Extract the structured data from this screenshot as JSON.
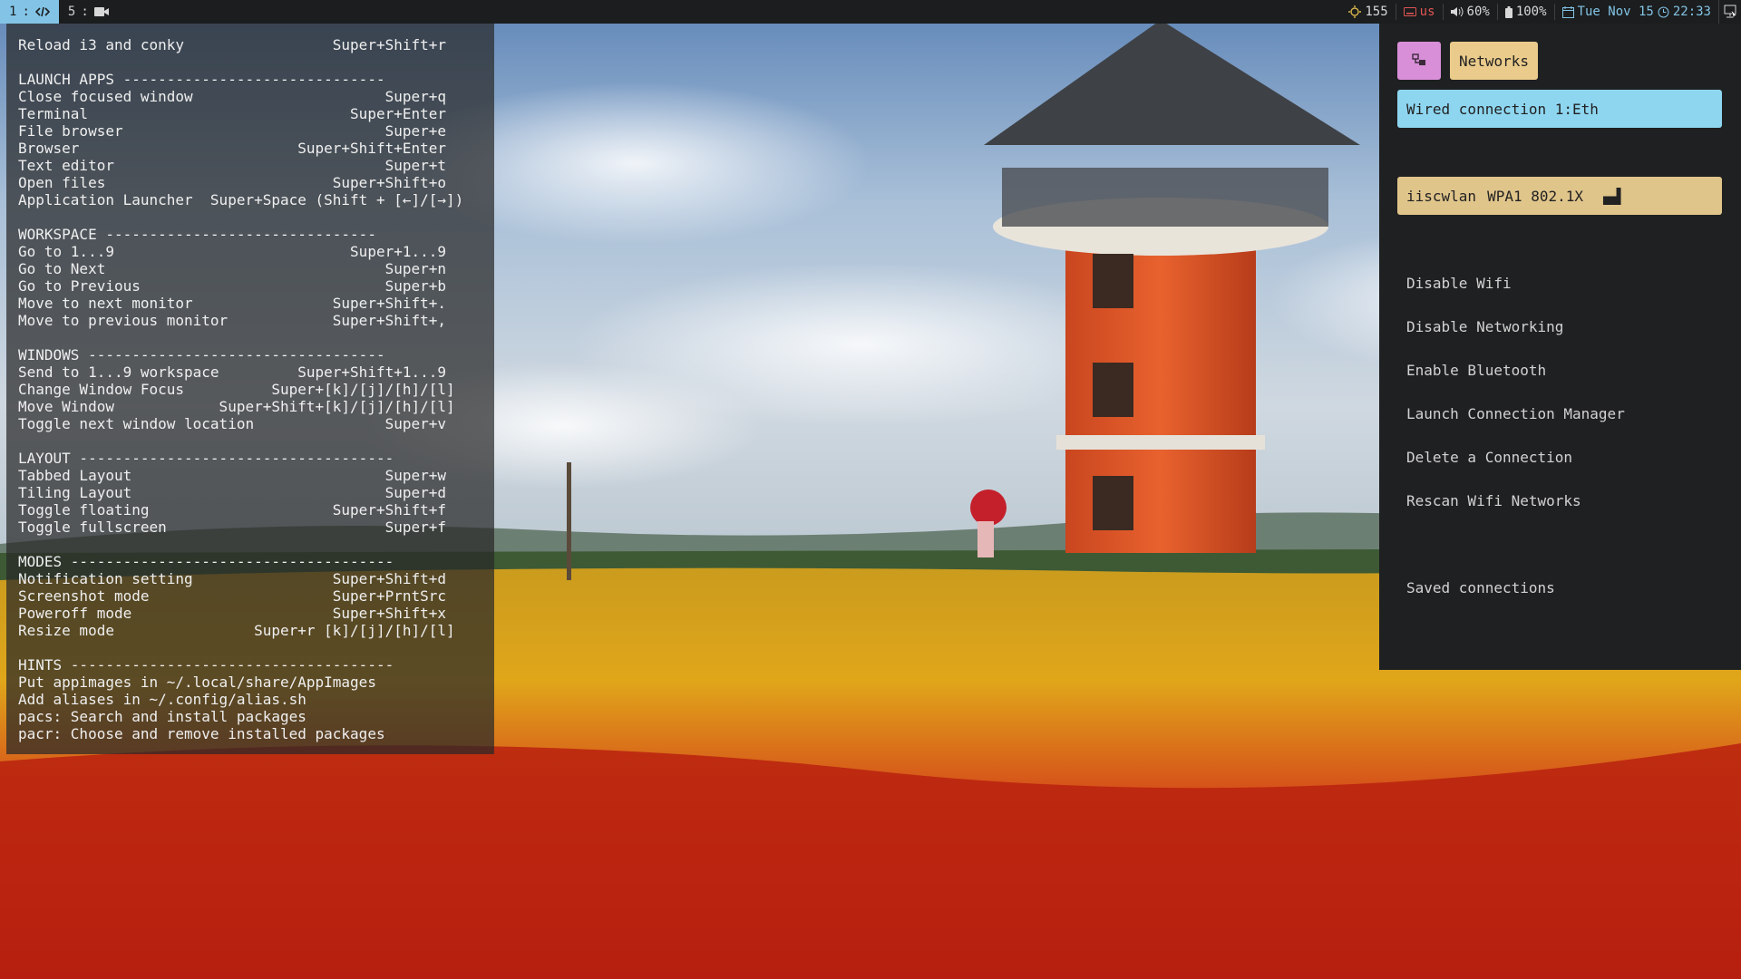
{
  "topbar": {
    "workspaces": [
      {
        "num": "1",
        "sep": ":",
        "icon": "code-icon",
        "active": true
      },
      {
        "num": "5",
        "sep": ":",
        "icon": "video-camera-icon",
        "active": false
      }
    ],
    "brightness": "155",
    "keyboard_layout": "us",
    "volume": "60%",
    "battery": "100%",
    "date": "Tue Nov 15",
    "time": "22:33",
    "accent_color": "#83c4e6",
    "keyboard_color": "#e05555"
  },
  "cheatsheet": {
    "lines": [
      "Reload i3 and conky                 Super+Shift+r",
      "",
      "LAUNCH APPS ------------------------------",
      "Close focused window                      Super+q",
      "Terminal                              Super+Enter",
      "File browser                              Super+e",
      "Browser                         Super+Shift+Enter",
      "Text editor                               Super+t",
      "Open files                          Super+Shift+o",
      "Application Launcher  Super+Space (Shift + [←]/[→])",
      "",
      "WORKSPACE -------------------------------",
      "Go to 1...9                           Super+1...9",
      "Go to Next                                Super+n",
      "Go to Previous                            Super+b",
      "Move to next monitor                Super+Shift+.",
      "Move to previous monitor            Super+Shift+,",
      "",
      "WINDOWS ----------------------------------",
      "Send to 1...9 workspace         Super+Shift+1...9",
      "Change Window Focus          Super+[k]/[j]/[h]/[l]",
      "Move Window            Super+Shift+[k]/[j]/[h]/[l]",
      "Toggle next window location               Super+v",
      "",
      "LAYOUT ------------------------------------",
      "Tabbed Layout                             Super+w",
      "Tiling Layout                             Super+d",
      "Toggle floating                     Super+Shift+f",
      "Toggle fullscreen                         Super+f",
      "",
      "MODES -------------------------------------",
      "Notification setting                Super+Shift+d",
      "Screenshot mode                     Super+PrntSrc",
      "Poweroff mode                       Super+Shift+x",
      "Resize mode                Super+r [k]/[j]/[h]/[l]",
      "",
      "HINTS -------------------------------------",
      "Put appimages in ~/.local/share/AppImages",
      "Add aliases in ~/.config/alias.sh",
      "pacs: Search and install packages",
      "pacr: Choose and remove installed packages"
    ]
  },
  "network_menu": {
    "prompt": "Networks",
    "wired": "Wired connection 1:Eth",
    "wifi_ssid": "iiscwlan",
    "wifi_security": "WPA1 802.1X",
    "wifi_signal": "▄▟",
    "options": [
      "Disable Wifi",
      "Disable Networking",
      "Enable Bluetooth",
      "Launch Connection Manager",
      "Delete a Connection",
      "Rescan Wifi Networks"
    ],
    "saved": "Saved connections",
    "colors": {
      "mode_button": "#d88fd8",
      "prompt": "#eacb8b",
      "wired_highlight": "#8ed6f0",
      "wifi_entry": "#e0c58b"
    }
  }
}
